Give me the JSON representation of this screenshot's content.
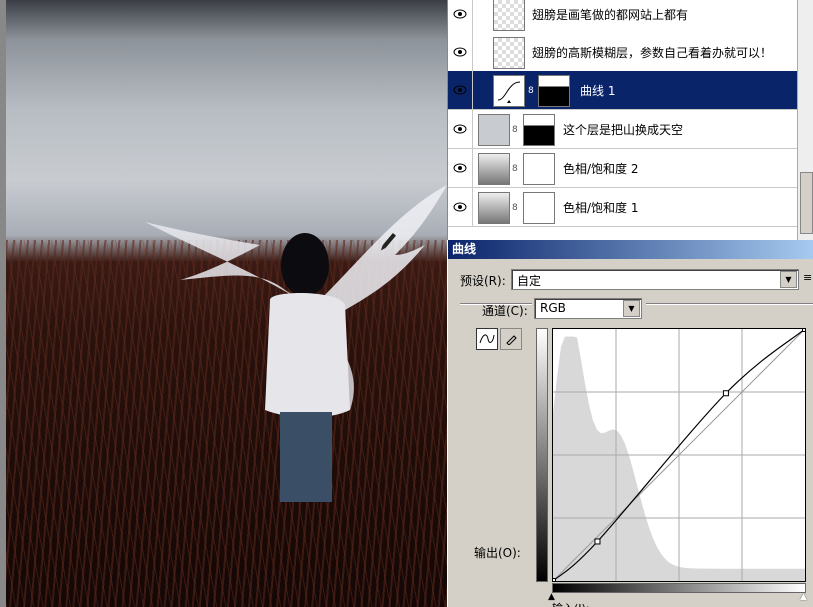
{
  "layers": [
    {
      "name": "翅膀是画笔做的都网站上都有",
      "type": "pixel",
      "visible": true,
      "selected": false,
      "has_mask": false
    },
    {
      "name": "翅膀的高斯模糊层，参数自己看着办就可以！",
      "type": "pixel",
      "visible": true,
      "selected": false,
      "has_mask": false
    },
    {
      "name": "曲线 1",
      "type": "curves",
      "visible": true,
      "selected": true,
      "has_mask": true
    },
    {
      "name": "这个层是把山换成天空",
      "type": "pixel",
      "visible": true,
      "selected": false,
      "has_mask": true
    },
    {
      "name": "色相/饱和度 2",
      "type": "adjustment",
      "visible": true,
      "selected": false,
      "has_mask": true
    },
    {
      "name": "色相/饱和度 1",
      "type": "adjustment",
      "visible": true,
      "selected": false,
      "has_mask": true
    }
  ],
  "curves": {
    "title": "曲线",
    "preset_label": "预设(R):",
    "preset_value": "自定",
    "channel_label": "通道(C):",
    "channel_value": "RGB",
    "output_label": "输出(O):",
    "input_label": "输入(I):",
    "tools": [
      "curve-point-tool",
      "pencil-tool"
    ],
    "points": [
      [
        0,
        0
      ],
      [
        45,
        40
      ],
      [
        175,
        190
      ],
      [
        255,
        255
      ]
    ]
  },
  "colors": {
    "selection": "#0a246a",
    "dialog_bg": "#d4d0c8"
  }
}
